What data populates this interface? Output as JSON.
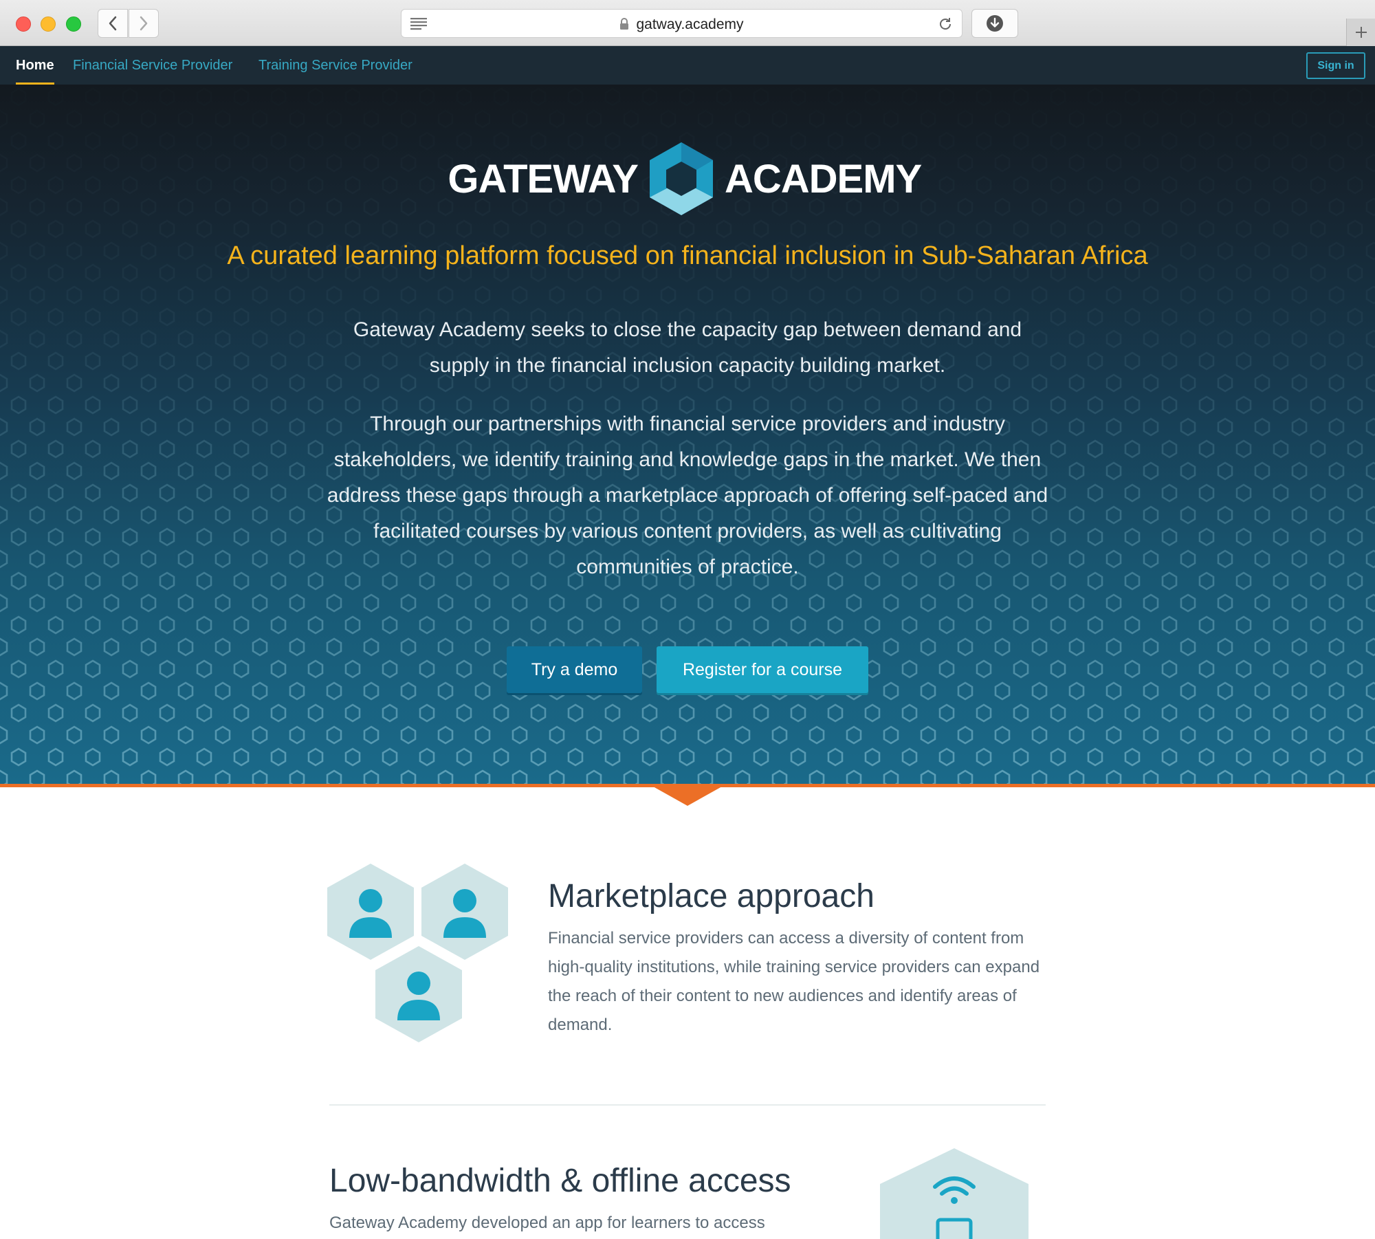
{
  "browser": {
    "url": "gatway.academy"
  },
  "nav": {
    "items": [
      {
        "label": "Home"
      },
      {
        "label": "Financial Service Provider"
      },
      {
        "label": "Training Service Provider"
      }
    ],
    "signin": "Sign in"
  },
  "hero": {
    "logo_left": "GATEWAY",
    "logo_right": "ACADEMY",
    "tagline": "A curated learning platform focused on financial inclusion in Sub-Saharan Africa",
    "paragraph1": "Gateway Academy seeks to close the capacity gap between demand and supply in the financial inclusion capacity building market.",
    "paragraph2": "Through our partnerships with financial service providers and industry stakeholders, we identify training and knowledge gaps in the market. We then address these gaps through a marketplace approach of offering self-paced and facilitated courses by various content providers, as well as cultivating communities of practice.",
    "buttons": {
      "demo": "Try a demo",
      "register": "Register for a course"
    }
  },
  "features": [
    {
      "title": "Marketplace approach",
      "body": "Financial service providers can access a diversity of content from high-quality institutions, while training service providers can expand the reach of their content to new audiences and identify areas of demand.",
      "icon": "users-hexagon-icon"
    },
    {
      "title": "Low-bandwidth & offline access",
      "body": "Gateway Academy developed an app for learners to access",
      "icon": "wifi-tablet-icon"
    }
  ],
  "colors": {
    "accent_yellow": "#f5b31c",
    "accent_orange": "#ec6f26",
    "brand_teal": "#1aa5c5",
    "brand_dark_blue": "#0f6e96",
    "nav_bg": "#1c2b36"
  }
}
